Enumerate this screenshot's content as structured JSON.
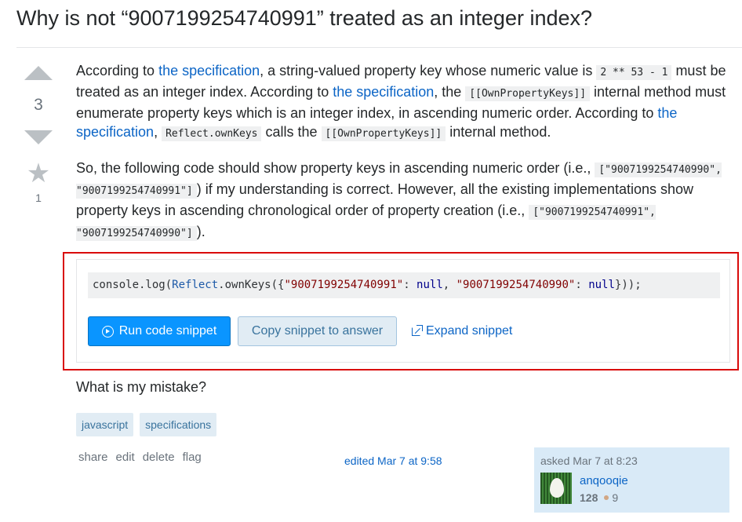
{
  "question": {
    "title": "Why is not “9007199254740991” treated as an integer index?"
  },
  "votes": {
    "count": "3",
    "favorites": "1",
    "upvote_icon": "triangle-up-icon",
    "downvote_icon": "triangle-down-icon",
    "favorite_icon": "star-icon"
  },
  "body": {
    "p1": {
      "t1": "According to ",
      "link1": "the specification",
      "t2": ", a string-valued property key whose numeric value is ",
      "code1": "2 ** 53 - 1",
      "t3": " must be treated as an integer index. According to ",
      "link2": "the specification",
      "t4": ", the ",
      "code2": "[[OwnPropertyKeys]]",
      "t5": " internal method must enumerate property keys which is an integer index, in ascending numeric order. According to ",
      "link3": "the specification",
      "t6": ", ",
      "code3": "Reflect.ownKeys",
      "t7": " calls the ",
      "code4": "[[OwnPropertyKeys]]",
      "t8": " internal method."
    },
    "p2": {
      "t1": "So, the following code should show property keys in ascending numeric order (i.e., ",
      "code1": "[\"9007199254740990\", \"9007199254740991\"]",
      "t2": ") if my understanding is correct. However, all the existing implementations show property keys in ascending chronological order of property creation (i.e., ",
      "code2": "[\"9007199254740991\", \"9007199254740990\"]",
      "t3": ")."
    },
    "closing": "What is my mistake?"
  },
  "snippet": {
    "code": {
      "a": "console.log(",
      "b": "Reflect",
      "c": ".ownKeys({",
      "d": "\"9007199254740991\"",
      "e": ": ",
      "f": "null",
      "g": ", ",
      "h": "\"9007199254740990\"",
      "i": ": ",
      "j": "null",
      "k": "}));"
    },
    "run_label": "Run code snippet",
    "copy_label": "Copy snippet to answer",
    "expand_label": "Expand snippet",
    "highlight_color": "#d90b0b"
  },
  "tags": [
    "javascript",
    "specifications"
  ],
  "post_menu": [
    "share",
    "edit",
    "delete",
    "flag"
  ],
  "edited": "edited Mar 7 at 9:58",
  "owner": {
    "asked": "asked Mar 7 at 8:23",
    "name": "anqooqie",
    "reputation": "128",
    "bronze_badges": "9"
  },
  "colors": {
    "link": "#0c65c6",
    "run_button": "#0a95ff",
    "tag_bg": "#e1ecf4",
    "owner_bg": "#d9eaf7"
  }
}
